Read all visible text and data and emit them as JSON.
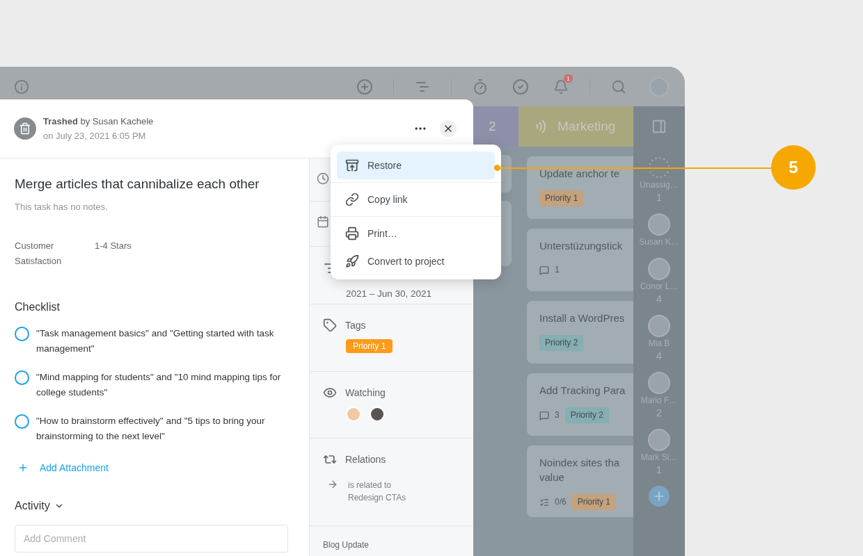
{
  "toolbar": {
    "notification_count": "1"
  },
  "task": {
    "trash_notice": {
      "text": "**Trashed** by Susan Kachele",
      "date": "on July 23, 2021 6:05 PM"
    },
    "title": "Merge articles that cannibalize each other",
    "notes": "This task has no notes.",
    "fields": [
      {
        "label": "Customer Satisfaction",
        "value": "1-4 Stars"
      }
    ],
    "checklist": {
      "title": "Checklist",
      "items": [
        {
          "text": "\"Task management basics\" and \"Getting started with task management\"",
          "checked": false
        },
        {
          "text": "\"Mind mapping for students\" and \"10 mind mapping tips for college students\"",
          "checked": false
        },
        {
          "text": "\"How to brainstorm effectively\" and \"5 tips to bring your brainstorming to the next level\"",
          "checked": false
        }
      ]
    },
    "add_attachment": "Add Attachment",
    "activity": {
      "title": "Activity",
      "comment_placeholder": "Add Comment"
    }
  },
  "details": {
    "date_range": "2021 – Jun 30, 2021",
    "tags": {
      "title": "Tags",
      "items": [
        {
          "label": "Priority 1",
          "color": "#ff9b1a"
        }
      ]
    },
    "watching": {
      "title": "Watching",
      "watchers": [
        {
          "kind": "light"
        },
        {
          "kind": "dark"
        }
      ]
    },
    "relations": {
      "title": "Relations",
      "items": [
        {
          "type": "is related to",
          "task": "Redesign CTAs"
        }
      ]
    },
    "project": "Blog Update"
  },
  "more_menu": {
    "items": [
      {
        "label": "Restore",
        "kind": "restore",
        "selected": true
      },
      {
        "label": "Copy link",
        "kind": "link",
        "selected": false
      },
      {
        "label": "Print…",
        "kind": "print",
        "selected": false
      },
      {
        "label": "Convert to project",
        "kind": "project",
        "selected": false
      }
    ]
  },
  "board": {
    "columns": [
      {
        "title": "2",
        "color": "#8e90aa"
      },
      {
        "title": "Marketing",
        "color": "#a9a77e",
        "cards": [
          {
            "title": "Update anchor te",
            "tags": [
              {
                "label": "Priority 1",
                "color": "#c4a27c"
              }
            ]
          },
          {
            "title": "Unterstüzungstick",
            "comments": "1"
          },
          {
            "title": "Install a WordPres",
            "tags": [
              {
                "label": "Priority 2",
                "color": "#86aeb3"
              }
            ]
          },
          {
            "title": "Add Tracking Para",
            "comments": "3",
            "tags": [
              {
                "label": "Priority 2",
                "color": "#86aeb3"
              }
            ]
          },
          {
            "title": "Noindex sites tha value",
            "checklist": "0/6",
            "tags": [
              {
                "label": "Priority 1",
                "color": "#c4a27c"
              }
            ]
          }
        ]
      }
    ],
    "people": [
      {
        "name": "Unassig…",
        "count": "1",
        "kind": "unassigned"
      },
      {
        "name": "Susan K…",
        "kind": "person"
      },
      {
        "name": "Conor L…",
        "count": "4",
        "kind": "person"
      },
      {
        "name": "Mia B",
        "count": "4",
        "kind": "person"
      },
      {
        "name": "Mario F…",
        "count": "2",
        "kind": "person"
      },
      {
        "name": "Mark Si…",
        "count": "1",
        "kind": "person"
      }
    ]
  },
  "callout": "5"
}
